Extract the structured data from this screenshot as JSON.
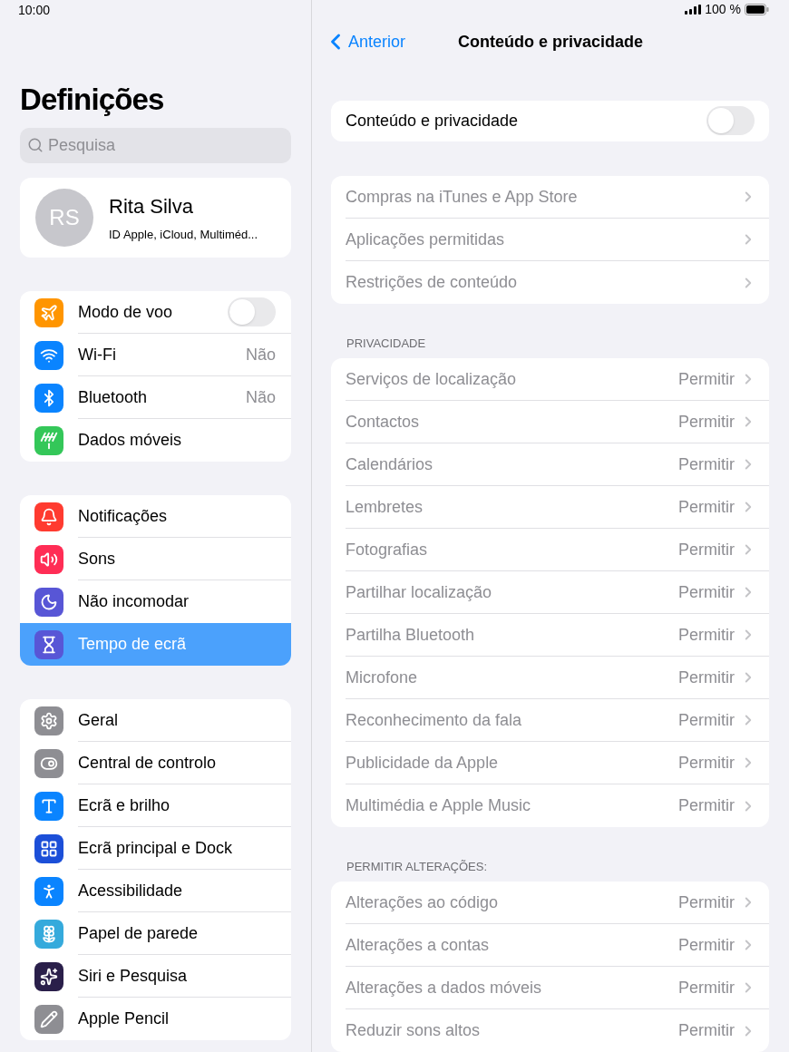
{
  "status_bar": {
    "time": "10:00",
    "battery": "100 %"
  },
  "sidebar": {
    "title": "Definições",
    "search": {
      "placeholder": "Pesquisa"
    },
    "profile": {
      "initials": "RS",
      "name": "Rita Silva",
      "subtitle": "ID Apple, iCloud, Multiméd..."
    },
    "groups": [
      [
        {
          "label": "Modo de voo",
          "kind": "toggle",
          "on": false,
          "color": "#ff9500",
          "selected": false
        },
        {
          "label": "Wi-Fi",
          "kind": "value",
          "value": "Não",
          "color": "#0a84ff",
          "selected": false
        },
        {
          "label": "Bluetooth",
          "kind": "value",
          "value": "Não",
          "color": "#0a84ff",
          "selected": false
        },
        {
          "label": "Dados móveis",
          "kind": "link",
          "color": "#34c759",
          "selected": false
        }
      ],
      [
        {
          "label": "Notificações",
          "kind": "link",
          "color": "#ff3b30",
          "selected": false
        },
        {
          "label": "Sons",
          "kind": "link",
          "color": "#ff2d55",
          "selected": false
        },
        {
          "label": "Não incomodar",
          "kind": "link",
          "color": "#5856d6",
          "selected": false
        },
        {
          "label": "Tempo de ecrã",
          "kind": "link",
          "color": "#5856d6",
          "selected": true
        }
      ],
      [
        {
          "label": "Geral",
          "kind": "link",
          "color": "#8e8e93",
          "selected": false
        },
        {
          "label": "Central de controlo",
          "kind": "link",
          "color": "#8e8e93",
          "selected": false
        },
        {
          "label": "Ecrã e brilho",
          "kind": "link",
          "color": "#0a84ff",
          "selected": false
        },
        {
          "label": "Ecrã principal e Dock",
          "kind": "link",
          "color": "#1c4fd8",
          "selected": false
        },
        {
          "label": "Acessibilidade",
          "kind": "link",
          "color": "#0a84ff",
          "selected": false
        },
        {
          "label": "Papel de parede",
          "kind": "link",
          "color": "#35aadc",
          "selected": false
        },
        {
          "label": "Siri e Pesquisa",
          "kind": "link",
          "color": "#2a1f4a",
          "selected": false
        },
        {
          "label": "Apple Pencil",
          "kind": "link",
          "color": "#8e8e93",
          "selected": false
        }
      ]
    ]
  },
  "detail": {
    "back": "Anterior",
    "title": "Conteúdo e privacidade",
    "master_toggle": {
      "label": "Conteúdo e privacidade",
      "on": false
    },
    "sections": [
      {
        "rows": [
          {
            "label": "Compras na iTunes e App Store",
            "disabled": true
          },
          {
            "label": "Aplicações permitidas",
            "disabled": true
          },
          {
            "label": "Restrições de conteúdo",
            "disabled": true
          }
        ]
      },
      {
        "header": "PRIVACIDADE",
        "rows": [
          {
            "label": "Serviços de localização",
            "value": "Permitir",
            "disabled": true
          },
          {
            "label": "Contactos",
            "value": "Permitir",
            "disabled": true
          },
          {
            "label": "Calendários",
            "value": "Permitir",
            "disabled": true
          },
          {
            "label": "Lembretes",
            "value": "Permitir",
            "disabled": true
          },
          {
            "label": "Fotografias",
            "value": "Permitir",
            "disabled": true
          },
          {
            "label": "Partilhar localização",
            "value": "Permitir",
            "disabled": true
          },
          {
            "label": "Partilha Bluetooth",
            "value": "Permitir",
            "disabled": true
          },
          {
            "label": "Microfone",
            "value": "Permitir",
            "disabled": true
          },
          {
            "label": "Reconhecimento da fala",
            "value": "Permitir",
            "disabled": true
          },
          {
            "label": "Publicidade da Apple",
            "value": "Permitir",
            "disabled": true
          },
          {
            "label": "Multimédia e Apple Music",
            "value": "Permitir",
            "disabled": true
          }
        ]
      },
      {
        "header": "PERMITIR ALTERAÇÕES:",
        "rows": [
          {
            "label": "Alterações ao código",
            "value": "Permitir",
            "disabled": true
          },
          {
            "label": "Alterações a contas",
            "value": "Permitir",
            "disabled": true
          },
          {
            "label": "Alterações a dados móveis",
            "value": "Permitir",
            "disabled": true
          },
          {
            "label": "Reduzir sons altos",
            "value": "Permitir",
            "disabled": true
          }
        ]
      }
    ]
  }
}
